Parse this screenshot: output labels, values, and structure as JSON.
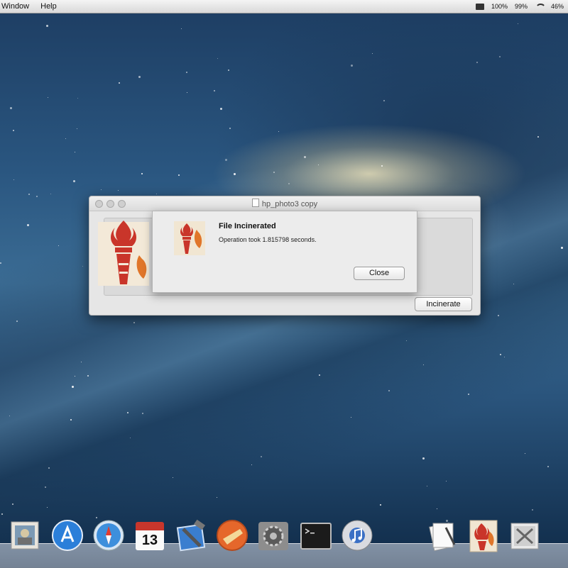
{
  "menubar": {
    "menus": [
      "Window",
      "Help"
    ],
    "status": {
      "item1": "100%",
      "item2": "99%",
      "battery": "46%"
    }
  },
  "window": {
    "title": "hp_photo3 copy",
    "incinerate_button": "Incinerate"
  },
  "dialog": {
    "title": "File Incinerated",
    "message": "Operation took 1.815798 seconds.",
    "close_button": "Close"
  },
  "dock": {
    "calendar_day": "13",
    "icons": [
      "photo-icon",
      "app-store-icon",
      "safari-icon",
      "calendar-icon",
      "xcode-icon",
      "cleaner-icon",
      "system-preferences-icon",
      "terminal-icon",
      "itunes-icon",
      "documents-stack-icon",
      "incinerator-icon",
      "utilities-stack-icon"
    ]
  },
  "colors": {
    "accent_torch": "#c9352a",
    "menubar": "#e8e8e8",
    "window_bg": "#e6e6e6"
  }
}
